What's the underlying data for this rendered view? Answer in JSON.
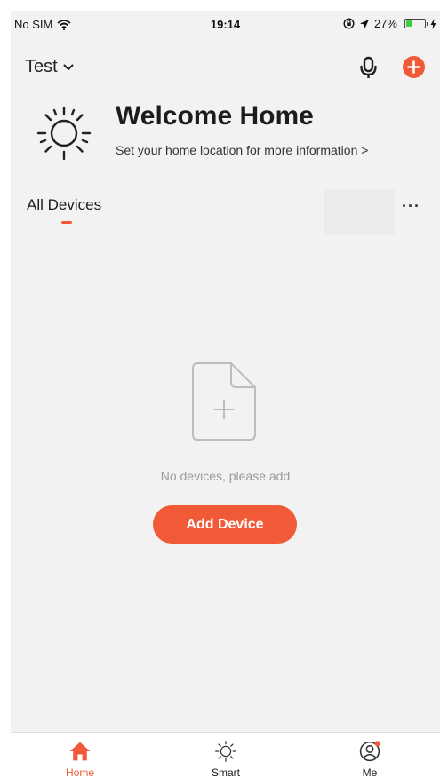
{
  "status_bar": {
    "carrier": "No SIM",
    "time": "19:14",
    "battery_percent": "27%",
    "battery_level": 0.27
  },
  "header": {
    "home_name": "Test"
  },
  "welcome": {
    "title": "Welcome Home",
    "subtitle": "Set your home location for more information >"
  },
  "tabs": {
    "active": "All Devices",
    "more": "···"
  },
  "empty_state": {
    "message": "No devices, please add",
    "button": "Add Device"
  },
  "bottom_nav": [
    {
      "label": "Home",
      "icon": "home-icon",
      "active": true
    },
    {
      "label": "Smart",
      "icon": "sun-icon",
      "active": false
    },
    {
      "label": "Me",
      "icon": "user-icon",
      "active": false
    }
  ],
  "colors": {
    "accent": "#f05a36",
    "background": "#f2f2f2",
    "muted_text": "#9a9a9a"
  }
}
